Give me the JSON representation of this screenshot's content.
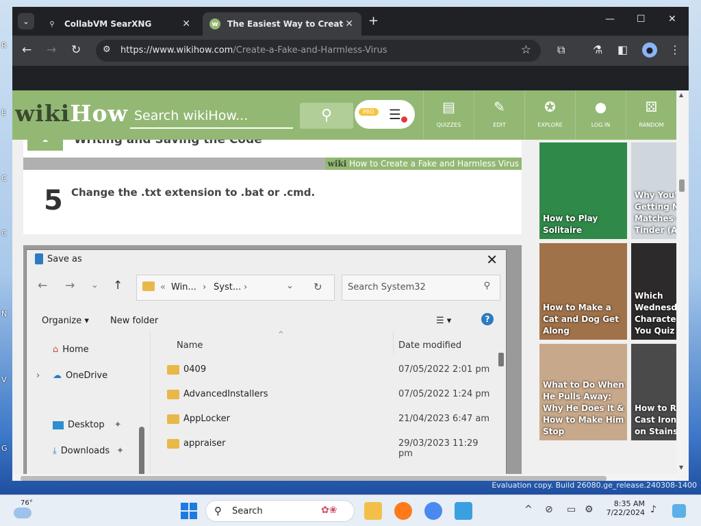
{
  "desktop": {
    "watermark": "Evaluation copy. Build 26080.ge_release.240308-1400",
    "left_letters": [
      "R",
      "E",
      "C",
      "C",
      "N",
      "V",
      "G"
    ]
  },
  "browser": {
    "tabs": [
      {
        "title": "CollabVM SearXNG",
        "active": false
      },
      {
        "title": "The Easiest Way to Create a Fa",
        "active": true
      }
    ],
    "url_host": "https://www.wikihow.com",
    "url_path": "/Create-a-Fake-and-Harmless-Virus"
  },
  "wikihow": {
    "logo_wiki": "wiki",
    "logo_how": "How",
    "search_placeholder": "Search wikiHow...",
    "pro_badge": "PRO",
    "nav": [
      {
        "label": "QUIZZES",
        "icon": "quizzes-icon",
        "glyph": "▤"
      },
      {
        "label": "EDIT",
        "icon": "pencil-icon",
        "glyph": "✎"
      },
      {
        "label": "EXPLORE",
        "icon": "compass-icon",
        "glyph": "✪"
      },
      {
        "label": "LOG IN",
        "icon": "user-icon",
        "glyph": "●"
      },
      {
        "label": "RANDOM",
        "icon": "dice-icon",
        "glyph": "⚄"
      }
    ],
    "section_badge": "1",
    "section_title": "Writing and Saving the Code",
    "banner_wiki": "wiki",
    "banner_text": "How to Create a Fake and Harmless Virus",
    "step_number": "5",
    "step_text": "Change the .txt extension to .bat or .cmd."
  },
  "save_dialog": {
    "title": "Save as",
    "path": [
      "Win...",
      "Syst..."
    ],
    "search_placeholder": "Search System32",
    "organize": "Organize",
    "new_folder": "New folder",
    "nav_items": [
      {
        "label": "Home",
        "icon": "home-icon"
      },
      {
        "label": "OneDrive",
        "icon": "onedrive-icon"
      },
      {
        "label": "Desktop",
        "icon": "desktop-icon"
      },
      {
        "label": "Downloads",
        "icon": "downloads-icon"
      }
    ],
    "columns": [
      "Name",
      "Date modified"
    ],
    "files": [
      {
        "name": "0409",
        "date": "07/05/2022 2:01 pm"
      },
      {
        "name": "AdvancedInstallers",
        "date": "07/05/2022 1:24 pm"
      },
      {
        "name": "AppLocker",
        "date": "21/04/2023 6:47 am"
      },
      {
        "name": "appraiser",
        "date": "29/03/2023 11:29 pm"
      }
    ]
  },
  "sidebar_cards": [
    {
      "title": "How to Play Solitaire",
      "color": "#2f8a4a"
    },
    {
      "title": "Why You're Getting No Matches on Tinder (And How",
      "color": "#cfd6dc"
    },
    {
      "title": "How to Make a Cat and Dog Get Along",
      "color": "#a0724a"
    },
    {
      "title": "Which Wednesday Character Are You Quiz",
      "color": "#2c2a2a"
    },
    {
      "title": "What to Do When He Pulls Away: Why He Does It & How to Make Him Stop",
      "color": "#c8a88a"
    },
    {
      "title": "How to Restore Cast Iron Burnt-on Stains",
      "color": "#4a4a4a"
    }
  ],
  "taskbar": {
    "temperature": "76°",
    "search_label": "Search",
    "time": "8:35 AM",
    "date": "7/22/2024"
  }
}
